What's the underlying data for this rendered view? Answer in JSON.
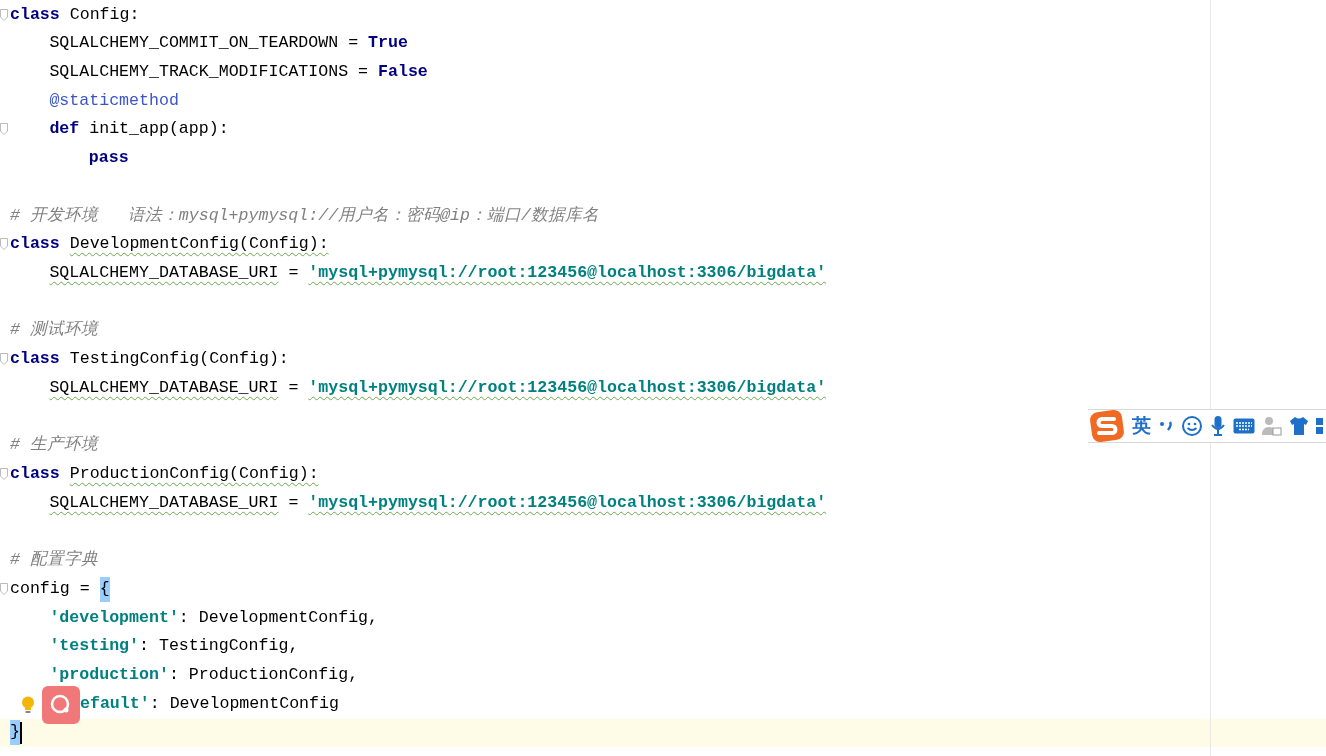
{
  "editor": {
    "lines": [
      {
        "tokens": [
          {
            "text": "class",
            "kind": "kw"
          },
          {
            "text": "Config:",
            "kind": "id"
          }
        ],
        "children": [
          {
            "tokens": [
              {
                "text": "SQLALCHEMY_COMMIT_ON_TEARDOWN",
                "kind": "id"
              },
              {
                "text": "=",
                "kind": "id"
              },
              {
                "text": "True",
                "kind": "kw"
              }
            ]
          },
          {
            "tokens": [
              {
                "text": "SQLALCHEMY_TRACK_MODIFICATIONS",
                "kind": "id"
              },
              {
                "text": "=",
                "kind": "id"
              },
              {
                "text": "False",
                "kind": "kw"
              }
            ]
          },
          {
            "tokens": [
              {
                "text": "@staticmethod",
                "kind": "deco"
              }
            ]
          },
          {
            "tokens": [
              {
                "text": "def",
                "kind": "kw"
              },
              {
                "text": "init_app(app):",
                "kind": "id"
              }
            ],
            "children": [
              {
                "tokens": [
                  {
                    "text": "pass",
                    "kind": "kw"
                  }
                ]
              }
            ]
          }
        ]
      },
      {
        "kind": "blank"
      },
      {
        "tokens": [
          {
            "text": "# 开发环境   语法：mysql+pymysql://用户名：密码@ip：端口/数据库名",
            "kind": "cmt"
          }
        ]
      },
      {
        "tokens": [
          {
            "text": "class",
            "kind": "kw"
          },
          {
            "text": "DevelopmentConfig(Config):",
            "kind": "id",
            "typo": true
          }
        ],
        "children": [
          {
            "tokens": [
              {
                "text": "SQLALCHEMY_DATABASE_URI",
                "kind": "id",
                "typo": true
              },
              {
                "text": "=",
                "kind": "id"
              },
              {
                "text": "'mysql+pymysql://root:123456@localhost:3306/bigdata'",
                "kind": "str",
                "typo": true
              }
            ]
          }
        ]
      },
      {
        "kind": "blank"
      },
      {
        "tokens": [
          {
            "text": "# 测试环境",
            "kind": "cmt"
          }
        ]
      },
      {
        "tokens": [
          {
            "text": "class",
            "kind": "kw"
          },
          {
            "text": "TestingConfig(Config):",
            "kind": "id"
          }
        ],
        "children": [
          {
            "tokens": [
              {
                "text": "SQLALCHEMY_DATABASE_URI",
                "kind": "id",
                "typo": true
              },
              {
                "text": "=",
                "kind": "id"
              },
              {
                "text": "'mysql+pymysql://root:123456@localhost:3306/bigdata'",
                "kind": "str",
                "typo": true
              }
            ]
          }
        ]
      },
      {
        "kind": "blank"
      },
      {
        "tokens": [
          {
            "text": "# 生产环境",
            "kind": "cmt"
          }
        ]
      },
      {
        "tokens": [
          {
            "text": "class",
            "kind": "kw"
          },
          {
            "text": "ProductionConfig(Config):",
            "kind": "id",
            "typo": true
          }
        ],
        "children": [
          {
            "tokens": [
              {
                "text": "SQLALCHEMY_DATABASE_URI",
                "kind": "id",
                "typo": true
              },
              {
                "text": "=",
                "kind": "id"
              },
              {
                "text": "'mysql+pymysql://root:123456@localhost:3306/bigdata'",
                "kind": "str",
                "typo": true
              }
            ]
          }
        ]
      },
      {
        "kind": "blank"
      },
      {
        "tokens": [
          {
            "text": "# 配置字典",
            "kind": "cmt"
          }
        ]
      },
      {
        "tokens": [
          {
            "text": "config",
            "kind": "id"
          },
          {
            "text": "=",
            "kind": "id"
          },
          {
            "text": "{",
            "kind": "id",
            "match": true
          }
        ],
        "children": [
          {
            "tokens": [
              {
                "text": "'development'",
                "kind": "str"
              },
              {
                "text": ": DevelopmentConfig,",
                "kind": "tail"
              }
            ]
          },
          {
            "tokens": [
              {
                "text": "'testing'",
                "kind": "str"
              },
              {
                "text": ": TestingConfig,",
                "kind": "tail"
              }
            ]
          },
          {
            "tokens": [
              {
                "text": "'production'",
                "kind": "str"
              },
              {
                "text": ": ProductionConfig,",
                "kind": "tail"
              }
            ]
          },
          {
            "tokens": [
              {
                "text": "efault'",
                "kind": "str"
              },
              {
                "text": ": DevelopmentConfig",
                "kind": "tail"
              }
            ],
            "overlay": true,
            "bulb": true
          }
        ]
      },
      {
        "tokens": [
          {
            "text": "}",
            "kind": "id",
            "match": true
          }
        ],
        "current": true
      }
    ]
  },
  "ime_toolbar": {
    "mode": "英"
  }
}
